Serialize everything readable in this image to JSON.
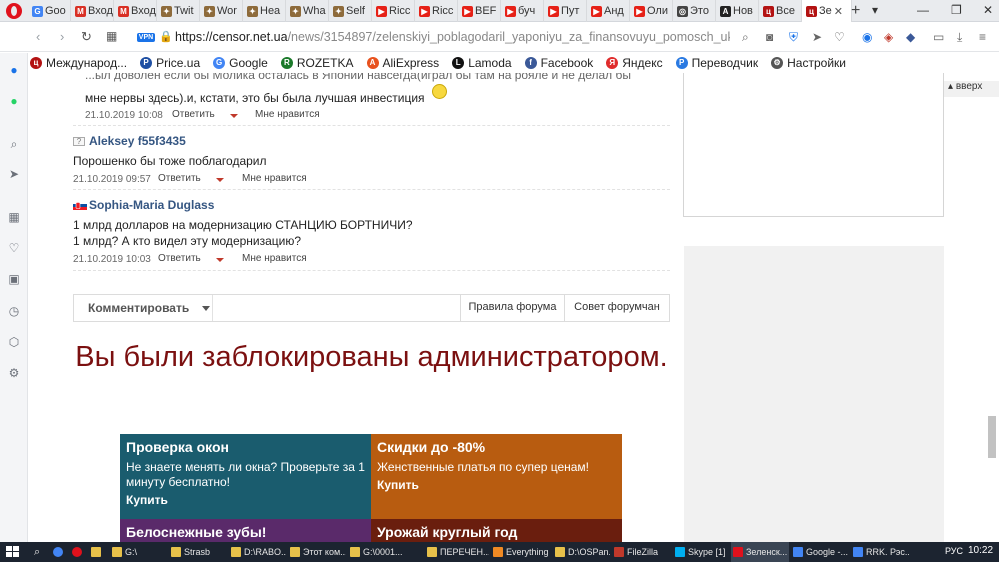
{
  "browser": {
    "tabs": [
      {
        "label": "Goo",
        "color": "#4285f4",
        "glyph": "G"
      },
      {
        "label": "Вход",
        "color": "#d93025",
        "glyph": "M"
      },
      {
        "label": "Вход",
        "color": "#d93025",
        "glyph": "M"
      },
      {
        "label": "Twit",
        "color": "#8e6b3b",
        "glyph": "✦"
      },
      {
        "label": "Wor",
        "color": "#8e6b3b",
        "glyph": "✦"
      },
      {
        "label": "Hea",
        "color": "#8e6b3b",
        "glyph": "✦"
      },
      {
        "label": "Wha",
        "color": "#8e6b3b",
        "glyph": "✦"
      },
      {
        "label": "Self",
        "color": "#8e6b3b",
        "glyph": "✦"
      },
      {
        "label": "Ricc",
        "color": "#e62117",
        "glyph": "▶"
      },
      {
        "label": "Ricc",
        "color": "#e62117",
        "glyph": "▶"
      },
      {
        "label": "BEF",
        "color": "#e62117",
        "glyph": "▶"
      },
      {
        "label": "буч",
        "color": "#e62117",
        "glyph": "▶"
      },
      {
        "label": "Пут",
        "color": "#e62117",
        "glyph": "▶"
      },
      {
        "label": "Анд",
        "color": "#e62117",
        "glyph": "▶"
      },
      {
        "label": "Оли",
        "color": "#e62117",
        "glyph": "▶"
      },
      {
        "label": "Это",
        "color": "#444444",
        "glyph": "◎"
      },
      {
        "label": "Нов",
        "color": "#222222",
        "glyph": "A"
      },
      {
        "label": "Все",
        "color": "#b31212",
        "glyph": "ц"
      },
      {
        "label": "Зе",
        "color": "#b31212",
        "glyph": "ц",
        "active": true
      }
    ],
    "new_tab_label": "+",
    "url_domain": "https://censor.net.ua",
    "url_path": "/news/3154897/zelenskiyi_poblagodaril_yaponiyu_za_finansovuyu_pomosch_ukr",
    "vpn_label": "VPN",
    "bookmarks": [
      {
        "label": "Международ...",
        "color": "#b31212",
        "glyph": "ц"
      },
      {
        "label": "Price.ua",
        "color": "#1e4fa3",
        "glyph": "P"
      },
      {
        "label": "Google",
        "color": "#4285f4",
        "glyph": "G"
      },
      {
        "label": "ROZETKA",
        "color": "#1b7a2a",
        "glyph": "R"
      },
      {
        "label": "AliExpress",
        "color": "#e8521e",
        "glyph": "A"
      },
      {
        "label": "Lamoda",
        "color": "#111111",
        "glyph": "L"
      },
      {
        "label": "Facebook",
        "color": "#3b5998",
        "glyph": "f"
      },
      {
        "label": "Яндекс",
        "color": "#e02c2c",
        "glyph": "Я"
      },
      {
        "label": "Переводчик",
        "color": "#2a7ae2",
        "glyph": "P"
      },
      {
        "label": "Настройки",
        "color": "#555555",
        "glyph": "⚙"
      }
    ]
  },
  "page": {
    "top_comment": {
      "partial_line": "...ыл доволен если бы Молика осталась в Японии навсегда(играл бы там на рояле и не делал бы",
      "line2": "мне нервы здесь).и, кстати, это бы была лучшая инвестиция",
      "date": "21.10.2019 10:08",
      "reply": "Ответить",
      "like": "Мне нравится"
    },
    "comments": [
      {
        "author": "Aleksey f55f3435",
        "lines": [
          "Порошенко бы тоже поблагодарил"
        ],
        "date": "21.10.2019 09:57",
        "reply": "Ответить",
        "like": "Мне нравится"
      },
      {
        "author": "Sophia-Maria Duglass",
        "lines": [
          "1 млрд долларов на модернизацию СТАНЦИЮ БОРТНИЧИ?",
          "1 млрд? А кто видел эту модернизацию?"
        ],
        "date": "21.10.2019 10:03",
        "reply": "Ответить",
        "like": "Мне нравится"
      }
    ],
    "toolbar": {
      "comment_label": "Комментировать",
      "rules_label": "Правила форума",
      "advice_label": "Совет форумчан"
    },
    "blocked_message": "Вы были заблокированы администратором.",
    "top_button": "вверх",
    "ads": [
      {
        "title": "Проверка окон",
        "text": "Не знаете менять ли окна? Проверьте за 1 минуту бесплатно!",
        "buy": "Купить",
        "color": "#1a5c6e"
      },
      {
        "title": "Скидки до -80%",
        "text": "Женственные платья по супер ценам!",
        "buy": "Купить",
        "color": "#b85c10"
      },
      {
        "title": "Белоснежные зубы!",
        "text": "",
        "buy": "",
        "color": "#5a2a6a"
      },
      {
        "title": "Урожай круглый год",
        "text": "",
        "buy": "",
        "color": "#6a1e0e"
      }
    ]
  },
  "taskbar": {
    "items": [
      {
        "label": "G:\\",
        "color": "#e7c14a"
      },
      {
        "label": "Strasb",
        "color": "#e7c14a"
      },
      {
        "label": "D:\\RABO...",
        "color": "#e7c14a"
      },
      {
        "label": "Этот ком...",
        "color": "#e7c14a"
      },
      {
        "label": "G:\\0001...",
        "color": "#e7c14a"
      },
      {
        "label": "ПЕРЕЧЕН...",
        "color": "#e7c14a"
      },
      {
        "label": "Everything",
        "color": "#f08a24"
      },
      {
        "label": "D:\\OSPan...",
        "color": "#e7c14a"
      },
      {
        "label": "FileZilla",
        "color": "#c0392b"
      },
      {
        "label": "Skype [1]",
        "color": "#00aff0"
      },
      {
        "label": "Зеленск...",
        "color": "#e0111c",
        "active": true
      },
      {
        "label": "Google -...",
        "color": "#4285f4"
      },
      {
        "label": "RRK. Рэс...",
        "color": "#4285f4"
      }
    ],
    "lang": "РУС",
    "time": "10:22"
  }
}
